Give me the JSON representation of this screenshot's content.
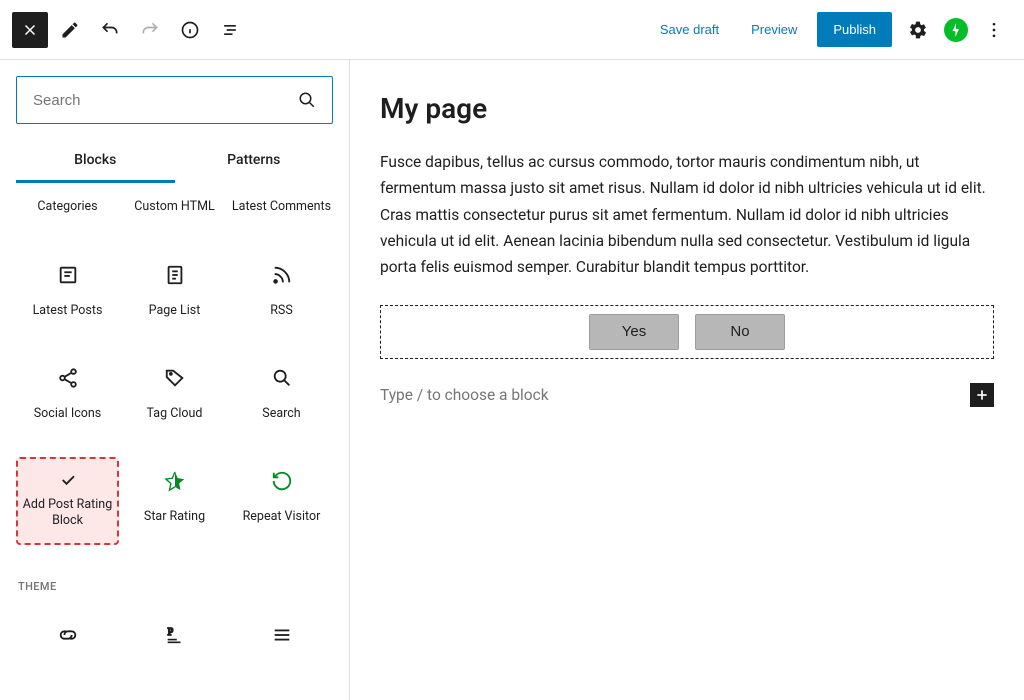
{
  "topbar": {
    "save_draft": "Save draft",
    "preview": "Preview",
    "publish": "Publish"
  },
  "sidebar": {
    "search_placeholder": "Search",
    "tabs": {
      "blocks": "Blocks",
      "patterns": "Patterns"
    },
    "blocks_row1": {
      "categories": "Categories",
      "custom_html": "Custom HTML",
      "latest_comments": "Latest Comments"
    },
    "blocks_row2": {
      "latest_posts": "Latest Posts",
      "page_list": "Page List",
      "rss": "RSS"
    },
    "blocks_row3": {
      "social_icons": "Social Icons",
      "tag_cloud": "Tag Cloud",
      "search": "Search"
    },
    "blocks_row4": {
      "add_post_rating": "Add Post Rating Block",
      "star_rating": "Star Rating",
      "repeat_visitor": "Repeat Visitor"
    },
    "theme_section_label": "THEME"
  },
  "editor": {
    "title": "My page",
    "body": "Fusce dapibus, tellus ac cursus commodo, tortor mauris condimentum nibh, ut fermentum massa justo sit amet risus. Nullam id dolor id nibh ultricies vehicula ut id elit. Cras mattis consectetur purus sit amet fermentum. Nullam id dolor id nibh ultricies vehicula ut id elit. Aenean lacinia bibendum nulla sed consectetur. Vestibulum id ligula porta felis euismod semper. Curabitur blandit tempus porttitor.",
    "yes_label": "Yes",
    "no_label": "No",
    "new_block_placeholder": "Type / to choose a block"
  }
}
